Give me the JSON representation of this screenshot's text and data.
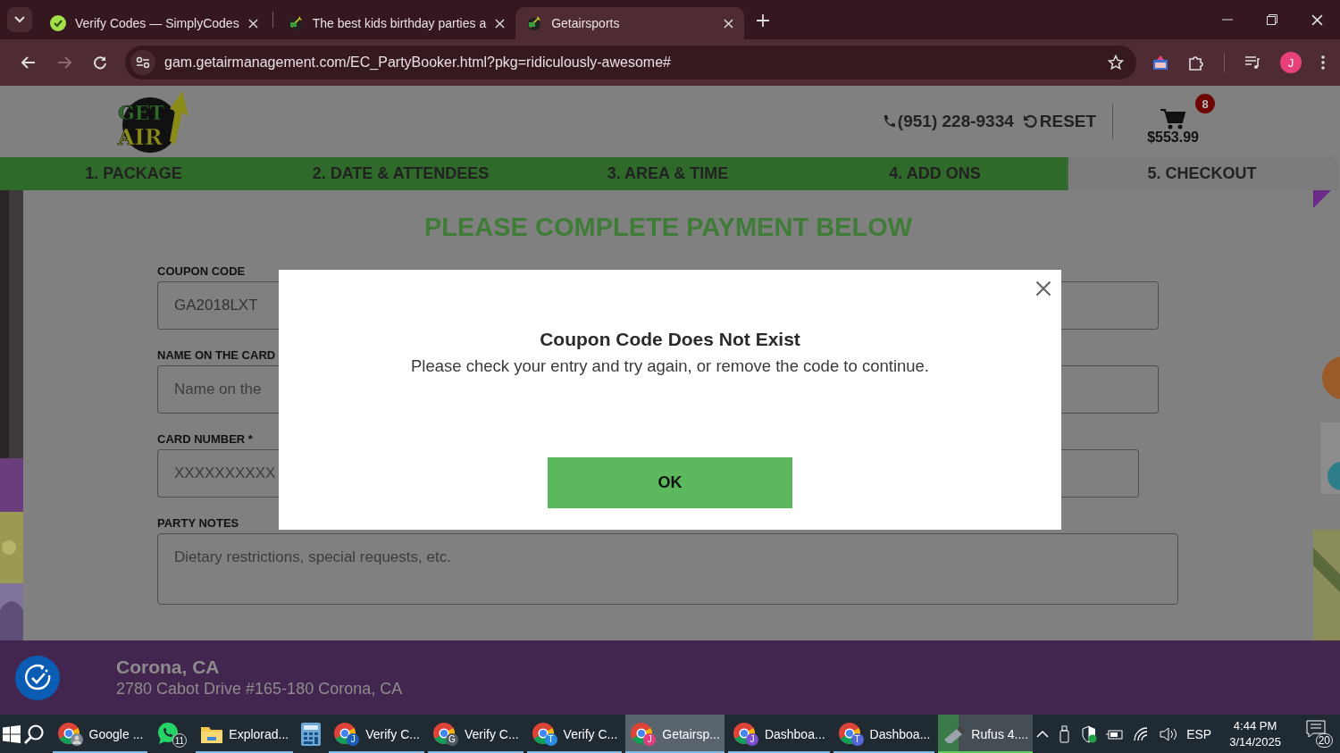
{
  "browser": {
    "tabs": [
      {
        "title": "Verify Codes — SimplyCodes",
        "selected": false
      },
      {
        "title": "The best kids birthday parties a",
        "selected": false
      },
      {
        "title": "Getairsports",
        "selected": true
      }
    ],
    "address": "gam.getairmanagement.com/EC_PartyBooker.html?pkg=ridiculously-awesome#",
    "profile": "J"
  },
  "header": {
    "logo": [
      "GET",
      "AIR"
    ],
    "phone": "(951) 228-9334",
    "reset": "RESET",
    "cart_count": "8",
    "cart_total": "$553.99"
  },
  "steps": [
    {
      "label": "1. PACKAGE",
      "selected": false
    },
    {
      "label": "2. DATE & ATTENDEES",
      "selected": false
    },
    {
      "label": "3. AREA & TIME",
      "selected": false
    },
    {
      "label": "4. ADD ONS",
      "selected": false
    },
    {
      "label": "5. CHECKOUT",
      "selected": true
    }
  ],
  "heading": "PLEASE COMPLETE PAYMENT BELOW",
  "form": {
    "fields": [
      {
        "label": "COUPON CODE",
        "value": "GA2018LXT"
      },
      {
        "label": "NAME ON THE CARD",
        "placeholder": "Name on the"
      },
      {
        "label": "CARD NUMBER *",
        "placeholder": "XXXXXXXXXX"
      }
    ],
    "notes": {
      "label": "PARTY NOTES",
      "placeholder": "Dietary restrictions, special requests, etc."
    }
  },
  "dialog": {
    "title": "Coupon Code Does Not Exist",
    "message": "Please check your entry and try again, or remove the code to continue.",
    "button": "OK"
  },
  "footer": {
    "city": "Corona, CA",
    "address": "2780 Cabot Drive #165-180 Corona, CA"
  },
  "taskbar": {
    "apps": [
      {
        "kind": "chrome",
        "label": "Google ...",
        "running": true,
        "selected": false
      },
      {
        "kind": "whatsapp",
        "count": "11",
        "running": false,
        "selected": false
      },
      {
        "kind": "explorer",
        "label": "Explorad...",
        "running": true,
        "selected": false
      },
      {
        "kind": "calculator",
        "running": false,
        "selected": false
      },
      {
        "kind": "chrome",
        "label": "Verify C...",
        "badge": "J",
        "color": "#1c5fb8",
        "running": true,
        "selected": false
      },
      {
        "kind": "chrome",
        "label": "Verify C...",
        "badge": "G",
        "color": "#505a63",
        "running": true,
        "selected": false
      },
      {
        "kind": "chrome",
        "label": "Verify C...",
        "badge": "T",
        "color": "#2b8be0",
        "running": true,
        "selected": false
      },
      {
        "kind": "chrome",
        "label": "Getairsp...",
        "badge": "J",
        "color": "#e23d7d",
        "running": true,
        "selected": true
      },
      {
        "kind": "chrome",
        "label": "Dashboa...",
        "badge": "J",
        "color": "#7a4fd0",
        "running": true,
        "selected": false
      },
      {
        "kind": "chrome",
        "label": "Dashboa...",
        "badge": "T",
        "color": "#5566d6",
        "running": true,
        "selected": false
      },
      {
        "kind": "rufus",
        "label": "Rufus 4....",
        "level": 0.21,
        "running": true,
        "selected": false
      }
    ],
    "language": "ESP",
    "time": "4:44 PM",
    "date": "3/14/2025",
    "notifications": "20"
  }
}
